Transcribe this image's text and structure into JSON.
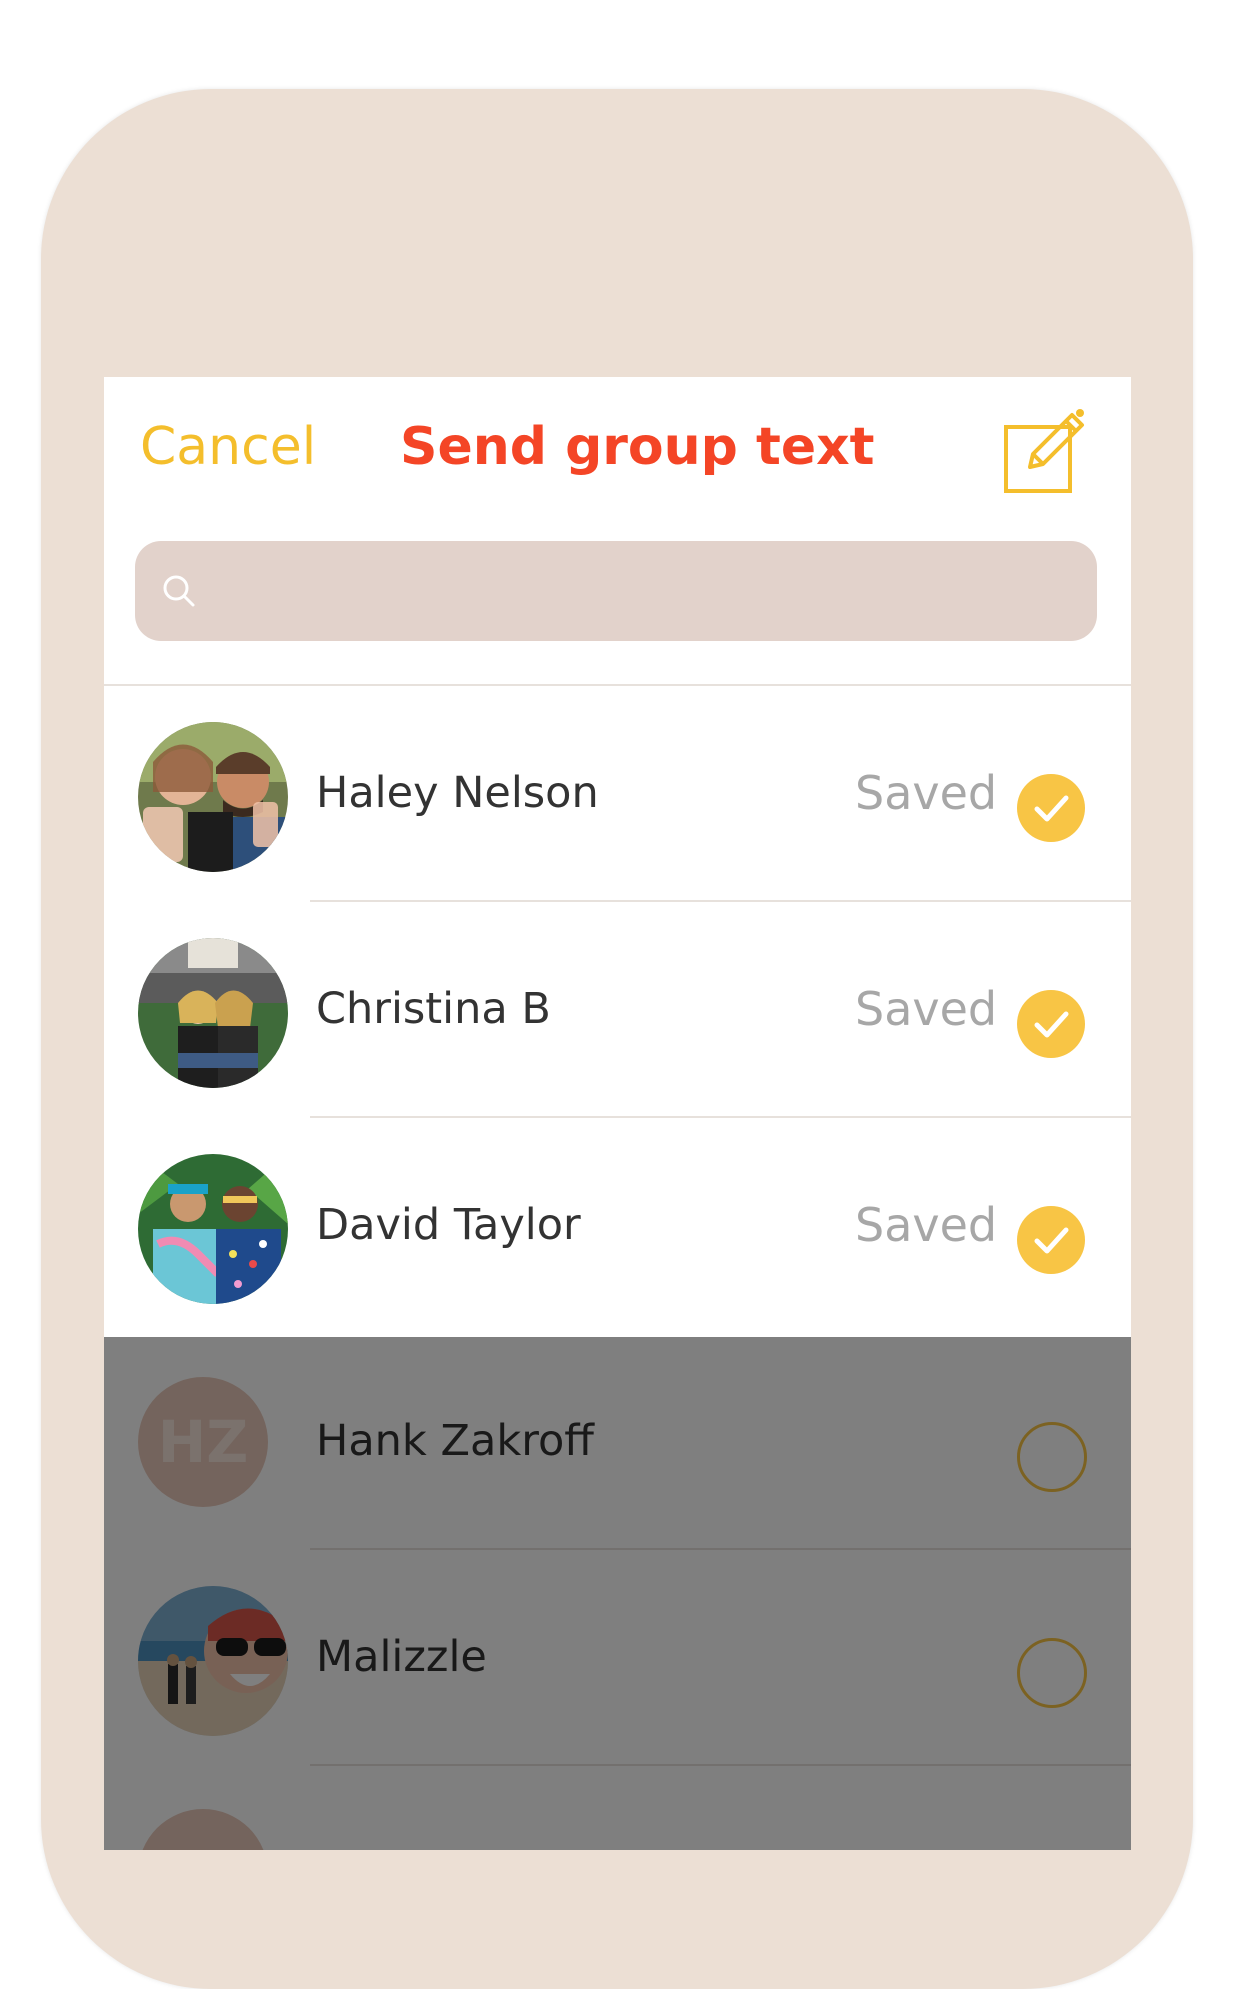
{
  "header": {
    "cancel_label": "Cancel",
    "title": "Send group text",
    "compose_icon": "compose-icon"
  },
  "search": {
    "icon": "search-icon",
    "placeholder": "",
    "value": ""
  },
  "contacts": [
    {
      "name": "Haley Nelson",
      "status": "Saved",
      "selected": true,
      "avatar": "photo"
    },
    {
      "name": "Christina B",
      "status": "Saved",
      "selected": true,
      "avatar": "photo"
    },
    {
      "name": "David Taylor",
      "status": "Saved",
      "selected": true,
      "avatar": "photo"
    },
    {
      "name": "Hank Zakroff",
      "status": "",
      "selected": false,
      "avatar": "initials",
      "initials": "HZ"
    },
    {
      "name": "Malizzle",
      "status": "",
      "selected": false,
      "avatar": "photo"
    },
    {
      "name": "",
      "status": "",
      "selected": false,
      "avatar": "initials",
      "initials": ""
    }
  ],
  "colors": {
    "accent_yellow": "#f8c545",
    "title_red": "#f44526",
    "cancel_yellow": "#f4be2c",
    "phone_frame": "#ecdfd4",
    "search_bg": "#e2d2cb"
  }
}
